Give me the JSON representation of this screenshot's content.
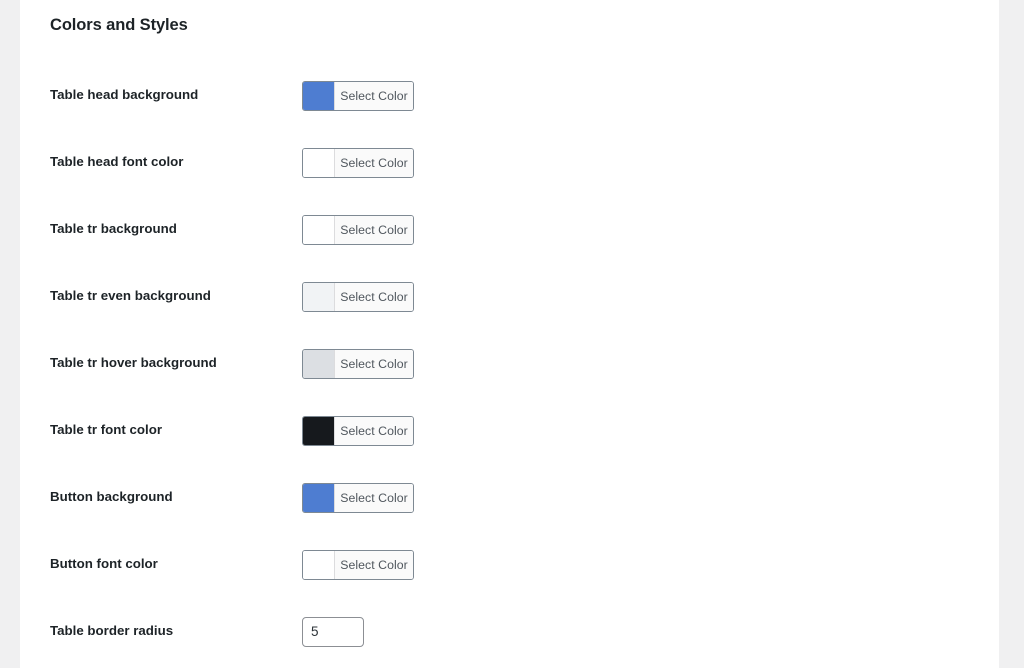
{
  "section": {
    "title": "Colors and Styles"
  },
  "picker": {
    "button_label": "Select Color"
  },
  "rows": [
    {
      "id": "table-head-background",
      "label": "Table head background",
      "control": "color",
      "color": "#4e7dd1"
    },
    {
      "id": "table-head-font-color",
      "label": "Table head font color",
      "control": "color",
      "color": "#ffffff"
    },
    {
      "id": "table-tr-background",
      "label": "Table tr background",
      "control": "color",
      "color": "#ffffff"
    },
    {
      "id": "table-tr-even-background",
      "label": "Table tr even background",
      "control": "color",
      "color": "#f1f3f5"
    },
    {
      "id": "table-tr-hover-background",
      "label": "Table tr hover background",
      "control": "color",
      "color": "#dcdfe3"
    },
    {
      "id": "table-tr-font-color",
      "label": "Table tr font color",
      "control": "color",
      "color": "#16191d"
    },
    {
      "id": "button-background",
      "label": "Button background",
      "control": "color",
      "color": "#4e7dd1"
    },
    {
      "id": "button-font-color",
      "label": "Button font color",
      "control": "color",
      "color": "#ffffff"
    },
    {
      "id": "table-border-radius",
      "label": "Table border radius",
      "control": "number",
      "value": "5"
    }
  ]
}
